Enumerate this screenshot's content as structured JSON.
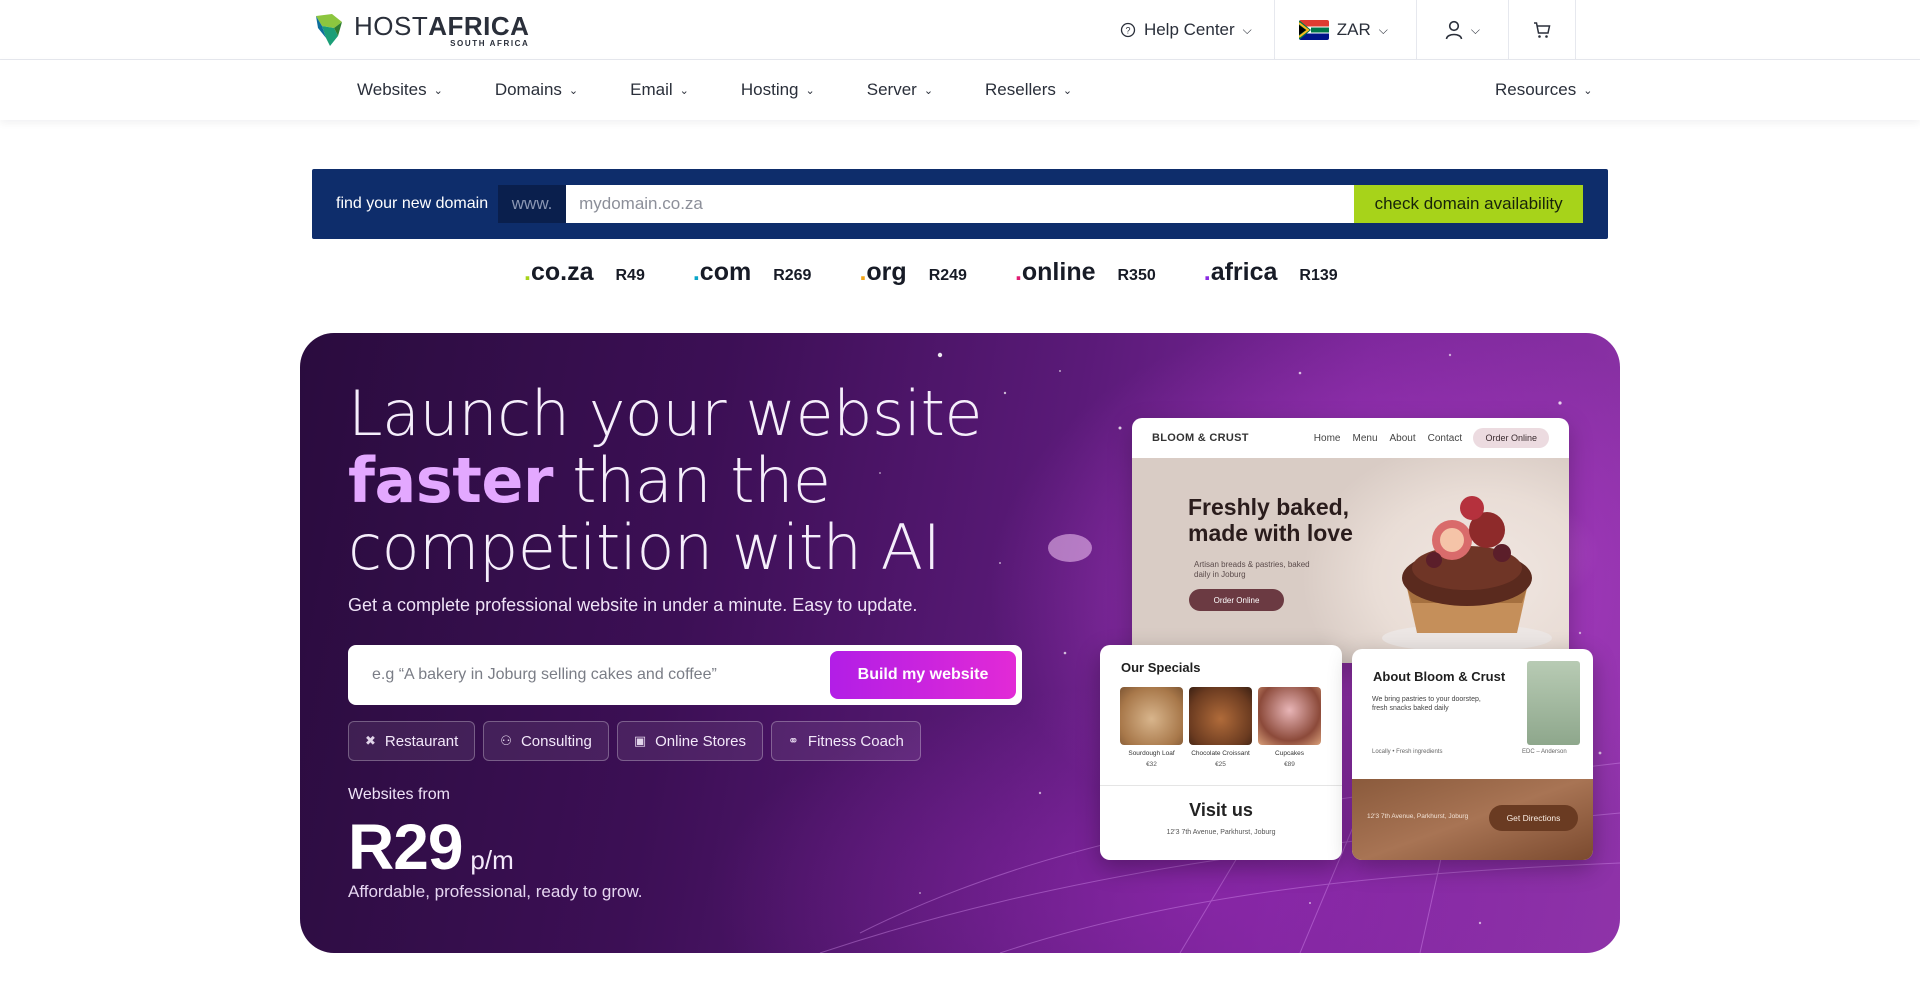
{
  "brand": {
    "name_part1": "HOST",
    "name_part2": "AFRICA",
    "subtitle": "SOUTH AFRICA"
  },
  "topbar": {
    "help_label": "Help Center",
    "currency": "ZAR",
    "icons": {
      "help": "question-circle-icon",
      "user": "user-icon",
      "cart": "cart-icon"
    }
  },
  "nav": {
    "items": [
      {
        "label": "Websites"
      },
      {
        "label": "Domains"
      },
      {
        "label": "Email"
      },
      {
        "label": "Hosting"
      },
      {
        "label": "Server"
      },
      {
        "label": "Resellers"
      }
    ],
    "resources_label": "Resources"
  },
  "domain_search": {
    "label": "find your new domain",
    "prefix": "www.",
    "placeholder": "mydomain.co.za",
    "button_label": "check domain availability",
    "colors": {
      "background": "#0e2d6b",
      "button": "#a7d31a"
    }
  },
  "tlds": [
    {
      "name": "co.za",
      "price": "R49",
      "dot_color": "#a7d31a"
    },
    {
      "name": "com",
      "price": "R269",
      "dot_color": "#0aa5c8"
    },
    {
      "name": "org",
      "price": "R249",
      "dot_color": "#f2a516"
    },
    {
      "name": "online",
      "price": "R350",
      "dot_color": "#e11d74"
    },
    {
      "name": "africa",
      "price": "R139",
      "dot_color": "#8a2be2"
    }
  ],
  "hero": {
    "title_line1": "Launch your website",
    "title_accent": "faster",
    "title_line2_rest": " than the",
    "title_line3": "competition with AI",
    "subtitle": "Get a complete professional website in under a minute. Easy to update.",
    "build_placeholder": "e.g “A bakery in Joburg selling cakes and coffee”",
    "build_button": "Build my website",
    "chips": [
      {
        "label": "Restaurant",
        "icon": "utensils-icon"
      },
      {
        "label": "Consulting",
        "icon": "people-icon"
      },
      {
        "label": "Online Stores",
        "icon": "store-icon"
      },
      {
        "label": "Fitness Coach",
        "icon": "dumbbell-icon"
      }
    ],
    "price_from": "Websites from",
    "price": "R29",
    "price_unit": "p/m",
    "tagline": "Affordable, professional, ready to grow."
  },
  "mock_site": {
    "brand": "BLOOM & CRUST",
    "links": [
      "Home",
      "Menu",
      "About",
      "Contact"
    ],
    "order_button": "Order Online",
    "headline_line1": "Freshly baked,",
    "headline_line2": "made with love",
    "blurb": "Artisan breads & pastries, baked daily in Joburg",
    "cta": "Order Online",
    "specials_title": "Our Specials",
    "specials": [
      {
        "name": "Sourdough Loaf",
        "price": "€32"
      },
      {
        "name": "Chocolate Croissant",
        "price": "€25"
      },
      {
        "name": "Cupcakes",
        "price": "€89"
      }
    ],
    "visit_title": "Visit us",
    "visit_address": "12'3 7th Avenue, Parkhurst, Joburg",
    "about_title": "About Bloom & Crust",
    "about_text": "We bring pastries to your doorstep, fresh snacks baked daily",
    "about_location": "Locally • Fresh ingredients",
    "chef_caption": "EDC – Anderson",
    "footer_address": "12'3 7th Avenue, Parkhurst, Joburg",
    "directions_button": "Get Directions"
  }
}
